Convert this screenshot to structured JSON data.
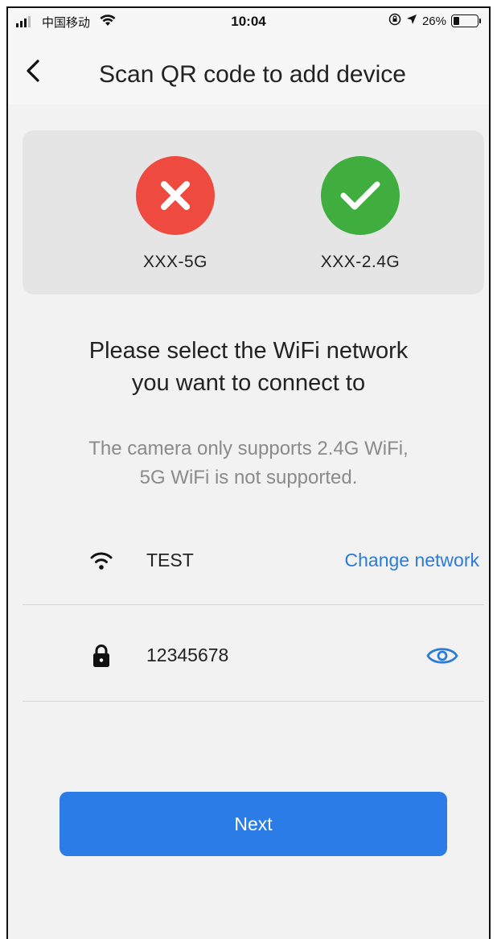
{
  "status_bar": {
    "carrier": "中国移动",
    "time": "10:04",
    "battery_text": "26%",
    "battery_level": 0.26
  },
  "header": {
    "title": "Scan QR code to add device",
    "back_icon": "chevron-left-icon"
  },
  "bands": {
    "unsupported": {
      "label": "XXX-5G",
      "icon": "cross-icon",
      "color": "#ee4a3f"
    },
    "supported": {
      "label": "XXX-2.4G",
      "icon": "check-icon",
      "color": "#3fae3f"
    }
  },
  "instructions": {
    "headline_line1": "Please select the WiFi network",
    "headline_line2": "you want to connect to",
    "note_line1": "The camera only supports 2.4G WiFi,",
    "note_line2": "5G WiFi is not supported."
  },
  "network": {
    "ssid": "TEST",
    "change_label": "Change network",
    "wifi_icon": "wifi-icon"
  },
  "password": {
    "value": "12345678",
    "lock_icon": "lock-icon",
    "eye_icon": "eye-icon"
  },
  "actions": {
    "next_label": "Next"
  },
  "colors": {
    "accent": "#2b7ce6",
    "link": "#2b7cd9"
  }
}
